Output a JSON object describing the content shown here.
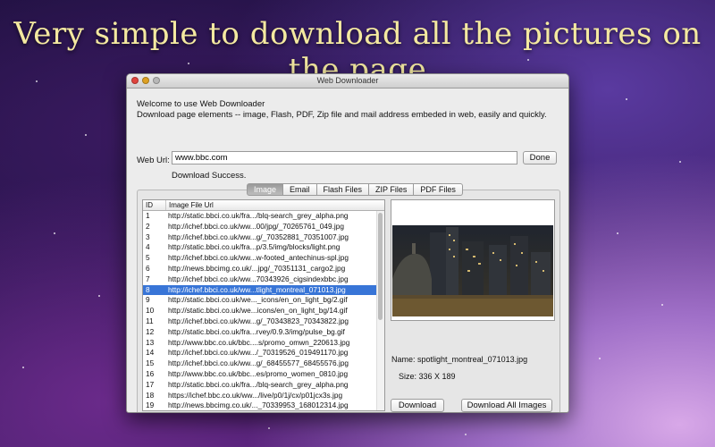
{
  "headline": "Very simple to download all the pictures on the page",
  "window": {
    "title": "Web Downloader"
  },
  "welcome": {
    "line1": "Welcome to use Web Downloader",
    "line2": "Download page elements -- image, Flash, PDF, Zip file and mail address embeded in web, easily and quickly."
  },
  "url": {
    "label": "Web Url:",
    "value": "www.bbc.com",
    "done_label": "Done"
  },
  "status": "Download Success.",
  "tabs": [
    {
      "label": "Image",
      "active": true
    },
    {
      "label": "Email"
    },
    {
      "label": "Flash Files"
    },
    {
      "label": "ZIP Files"
    },
    {
      "label": "PDF Files"
    }
  ],
  "table": {
    "col_id": "ID",
    "col_url": "Image File Url",
    "selected_id": "8",
    "rows": [
      {
        "id": "1",
        "url": "http://static.bbci.co.uk/fra.../blq-search_grey_alpha.png"
      },
      {
        "id": "2",
        "url": "http://ichef.bbci.co.uk/ww...00/jpg/_70265761_049.jpg"
      },
      {
        "id": "3",
        "url": "http://ichef.bbci.co.uk/ww...g/_70352881_70351007.jpg"
      },
      {
        "id": "4",
        "url": "http://static.bbci.co.uk/fra...p/3.5/img/blocks/light.png"
      },
      {
        "id": "5",
        "url": "http://ichef.bbci.co.uk/ww...w-footed_antechinus-spl.jpg"
      },
      {
        "id": "6",
        "url": "http://news.bbcimg.co.uk/...jpg/_70351131_cargo2.jpg"
      },
      {
        "id": "7",
        "url": "http://ichef.bbci.co.uk/ww...70343926_cigsindexbbc.jpg"
      },
      {
        "id": "8",
        "url": "http://ichef.bbci.co.uk/ww...tlight_montreal_071013.jpg"
      },
      {
        "id": "9",
        "url": "http://static.bbci.co.uk/we..._icons/en_on_light_bg/2.gif"
      },
      {
        "id": "10",
        "url": "http://static.bbci.co.uk/we...icons/en_on_light_bg/14.gif"
      },
      {
        "id": "11",
        "url": "http://ichef.bbci.co.uk/ww...g/_70343823_70343822.jpg"
      },
      {
        "id": "12",
        "url": "http://static.bbci.co.uk/fra...rvey/0.9.3/img/pulse_bg.gif"
      },
      {
        "id": "13",
        "url": "http://www.bbc.co.uk/bbc....s/promo_omwn_220613.jpg"
      },
      {
        "id": "14",
        "url": "http://ichef.bbci.co.uk/ww.../_70319526_019491170.jpg"
      },
      {
        "id": "15",
        "url": "http://ichef.bbci.co.uk/ww...g/_68455577_68455576.jpg"
      },
      {
        "id": "16",
        "url": "http://www.bbc.co.uk/bbc...es/promo_women_0810.jpg"
      },
      {
        "id": "17",
        "url": "http://static.bbci.co.uk/fra.../blq-search_grey_alpha.png"
      },
      {
        "id": "18",
        "url": "https://ichef.bbc.co.uk/ww.../live/p0/1j/cx/p01jcx3s.jpg"
      },
      {
        "id": "19",
        "url": "http://news.bbcimg.co.uk/..._70339953_168012314.jpg"
      }
    ]
  },
  "preview": {
    "name_label": "Name:",
    "name_value": "spotlight_montreal_071013.jpg",
    "size_label": "Size:",
    "size_value": "336 X 189"
  },
  "buttons": {
    "download": "Download",
    "download_all": "Download All Images"
  }
}
